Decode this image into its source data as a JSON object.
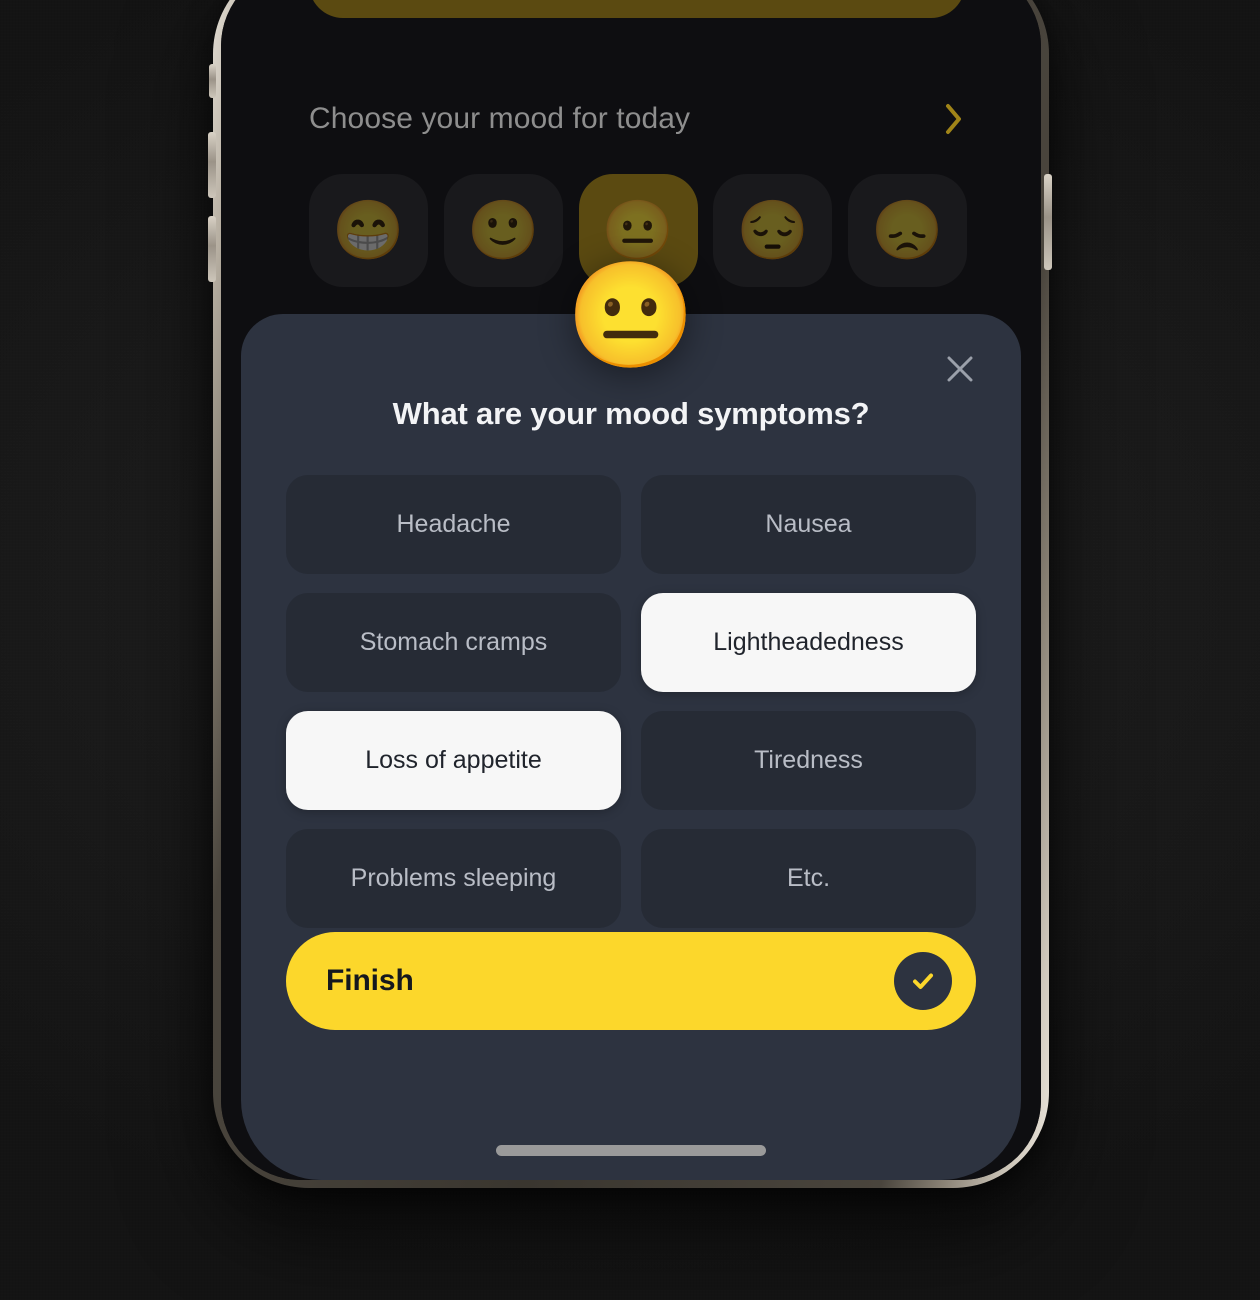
{
  "app": {
    "mood_section": {
      "title": "Choose your mood for today",
      "chevron_icon": "chevron-right-icon",
      "chevron_color": "#a08418",
      "moods": [
        {
          "name": "grinning",
          "glyph": "😁",
          "selected": false
        },
        {
          "name": "slightly-smiling",
          "glyph": "🙂",
          "selected": false
        },
        {
          "name": "neutral",
          "glyph": "😐",
          "selected": true
        },
        {
          "name": "pensive",
          "glyph": "😔",
          "selected": false
        },
        {
          "name": "disappointed",
          "glyph": "😞",
          "selected": false
        }
      ]
    }
  },
  "modal": {
    "floating_emoji": "😐",
    "close_icon": "close-x-icon",
    "title": "What are your mood symptoms?",
    "symptoms": [
      {
        "label": "Headache",
        "selected": false
      },
      {
        "label": "Nausea",
        "selected": false
      },
      {
        "label": "Stomach cramps",
        "selected": false
      },
      {
        "label": "Lightheadedness",
        "selected": true
      },
      {
        "label": "Loss of appetite",
        "selected": true
      },
      {
        "label": "Tiredness",
        "selected": false
      },
      {
        "label": "Problems sleeping",
        "selected": false
      },
      {
        "label": "Etc.",
        "selected": false
      }
    ],
    "finish_button": {
      "label": "Finish",
      "icon": "check-circle-icon",
      "background": "#fcd72b",
      "text_color": "#15181e"
    }
  },
  "theme": {
    "accent": "#fcd72b",
    "sheet_bg": "#2d3340",
    "chip_bg": "#262b35",
    "chip_selected_bg": "#f7f7f7",
    "screen_bg": "#0e0e11"
  }
}
